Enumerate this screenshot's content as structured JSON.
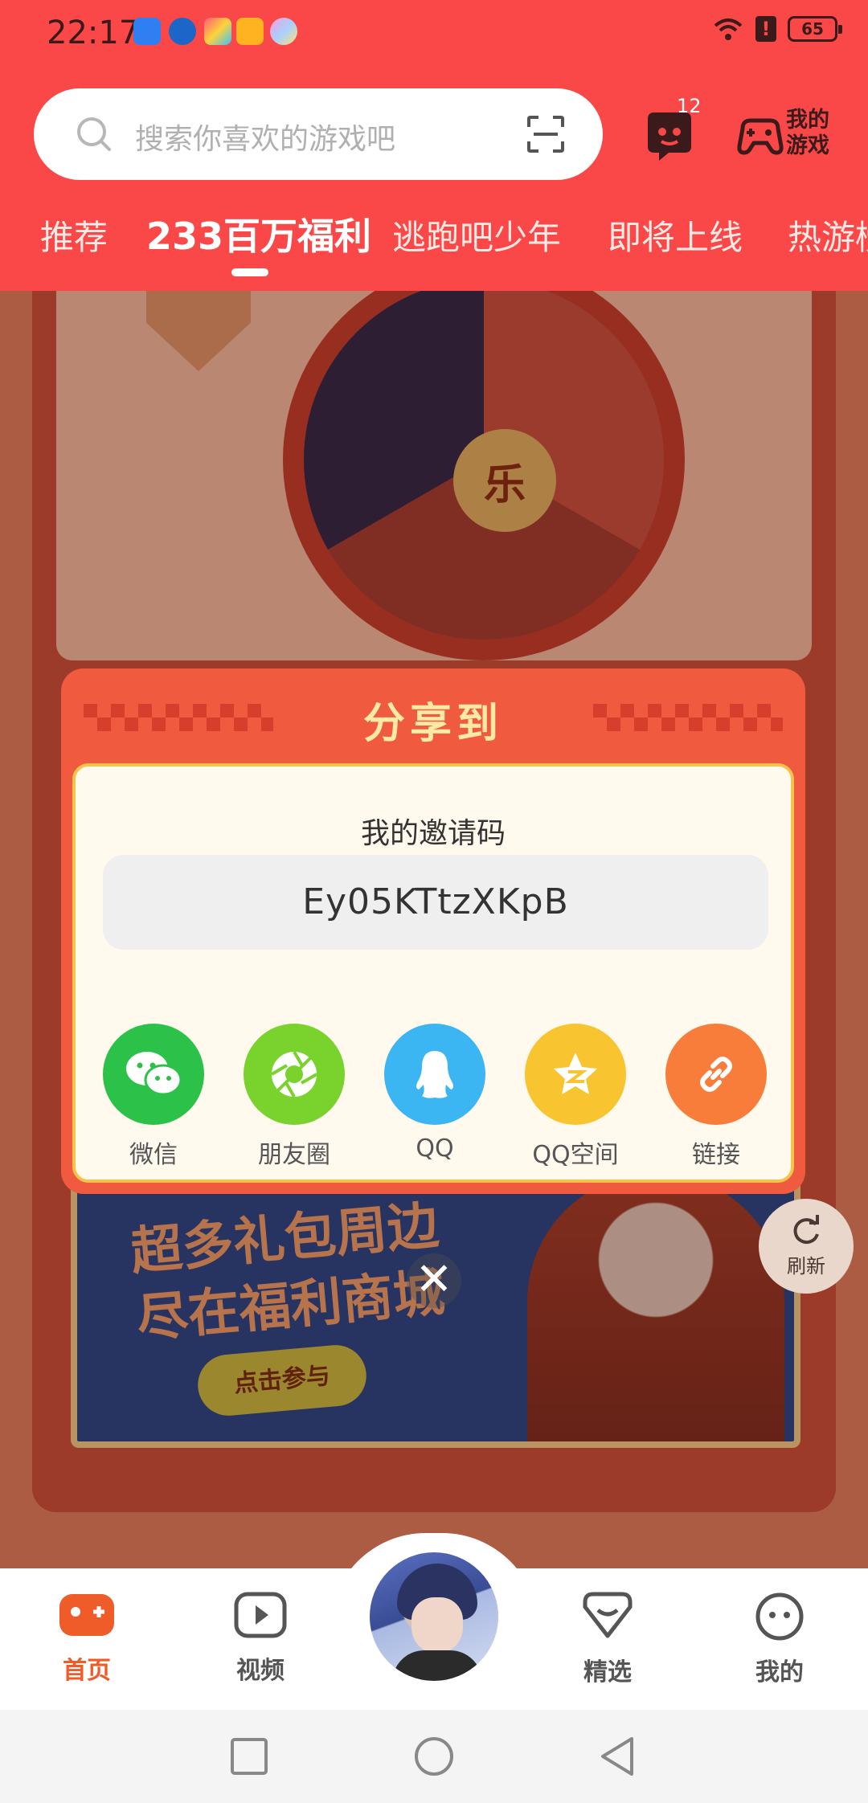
{
  "status_bar": {
    "time": "22:17",
    "battery": "65",
    "alert": "!",
    "notification_icons": [
      "shield-icon",
      "browser-icon",
      "app-icon",
      "video-icon",
      "gallery-icon"
    ]
  },
  "header": {
    "search_placeholder": "搜索你喜欢的游戏吧",
    "message_badge": "12",
    "my_games_label": "我的游戏",
    "tabs": [
      "推荐",
      "233百万福利",
      "逃跑吧少年",
      "即将上线",
      "热游榜"
    ],
    "active_tab": "233百万福利"
  },
  "background": {
    "wheel_center": "乐",
    "banner_title_line1": "超多礼包周边",
    "banner_title_line2": "尽在福利商城",
    "banner_button": "点击参与",
    "refresh_label": "刷新"
  },
  "dialog": {
    "title": "分享到",
    "invite_label": "我的邀请码",
    "invite_code": "Ey05KTtzXKpB",
    "share_targets": [
      {
        "label": "微信",
        "icon": "wechat-icon",
        "color": "#2cc24a"
      },
      {
        "label": "朋友圈",
        "icon": "moments-icon",
        "color": "#7ad22d"
      },
      {
        "label": "QQ",
        "icon": "qq-icon",
        "color": "#3cb6f2"
      },
      {
        "label": "QQ空间",
        "icon": "qzone-icon",
        "color": "#f8c531"
      },
      {
        "label": "链接",
        "icon": "link-icon",
        "color": "#f97d3a"
      }
    ],
    "close": "✕"
  },
  "bottom_nav": {
    "items": [
      {
        "label": "首页",
        "icon": "gamepad-icon"
      },
      {
        "label": "视频",
        "icon": "video-play-icon"
      },
      {
        "label": "精选",
        "icon": "heart-badge-icon"
      },
      {
        "label": "我的",
        "icon": "profile-face-icon"
      }
    ],
    "active": "首页"
  },
  "colors": {
    "brand_red": "#fa4848",
    "dialog_red": "#f05b3f",
    "active_orange": "#f05b2a"
  }
}
